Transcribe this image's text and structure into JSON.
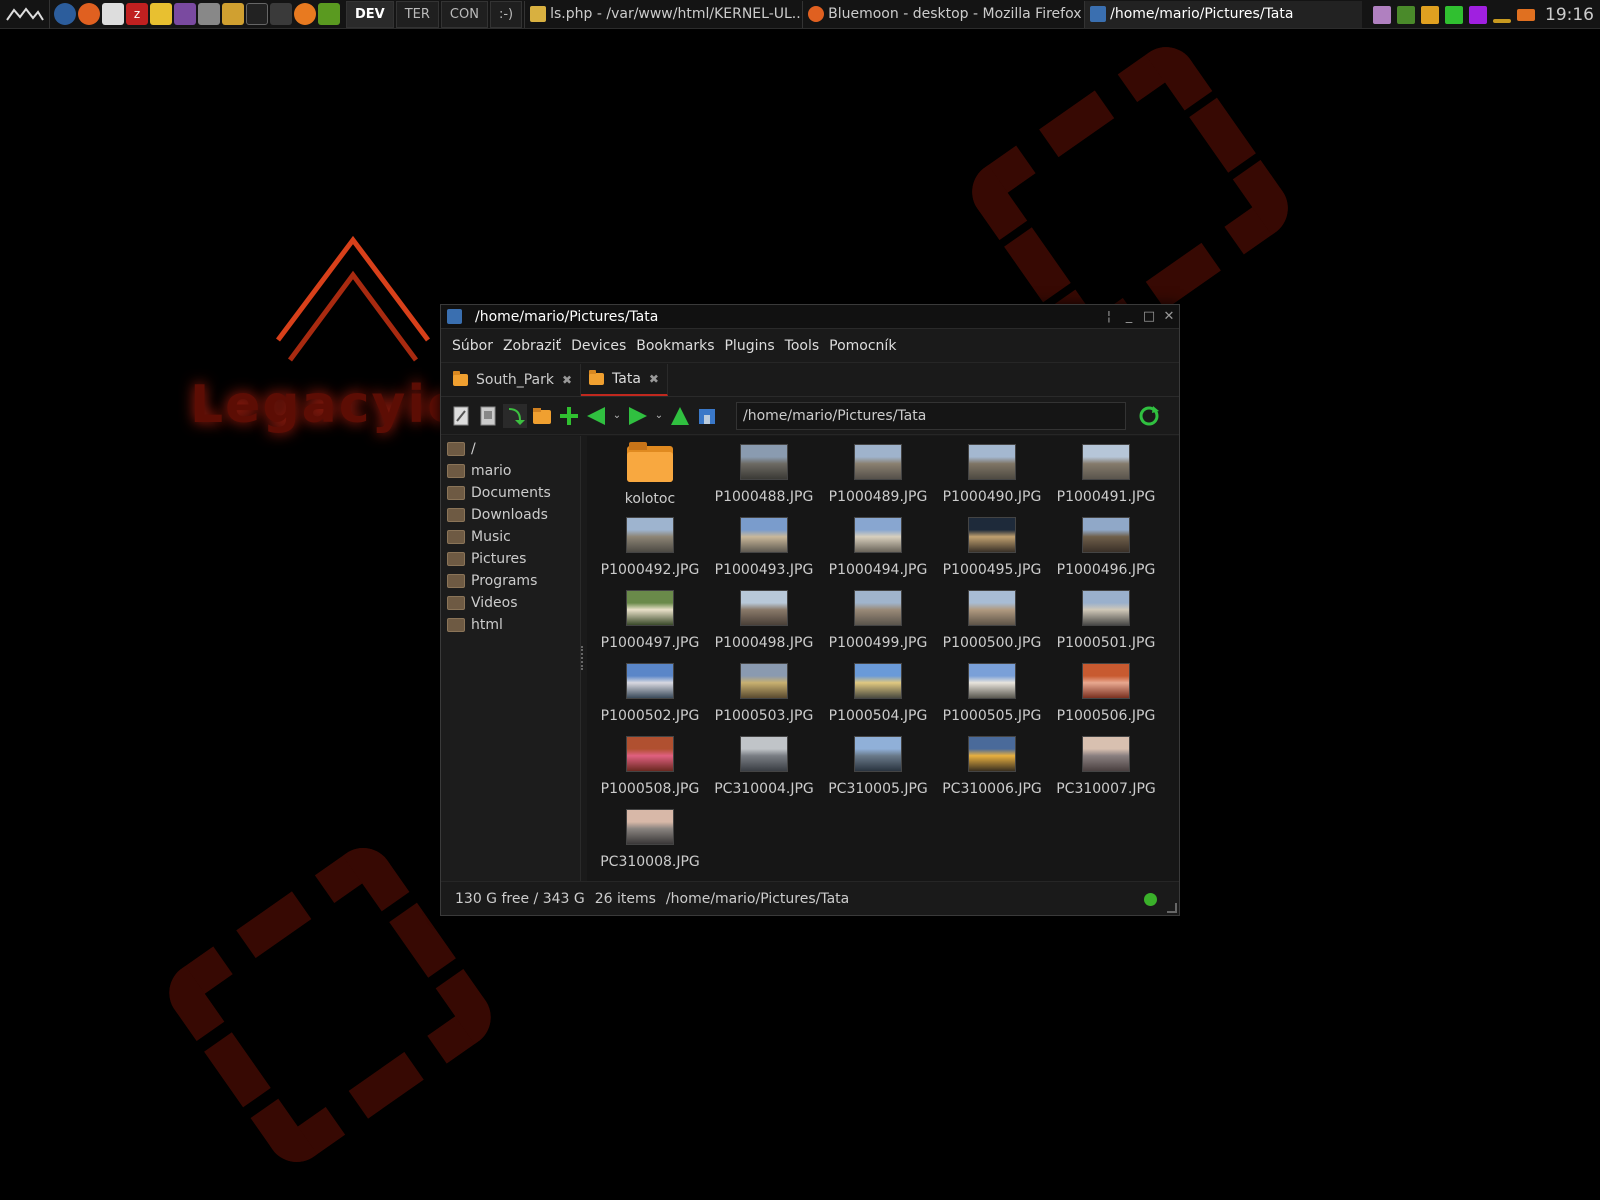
{
  "taskbar": {
    "desktops": [
      "DEV",
      "TER",
      "CON",
      ":-)"
    ],
    "tasks": [
      {
        "label": "ls.php - /var/www/html/KERNEL-UL..."
      },
      {
        "label": "Bluemoon - desktop - Mozilla Firefox"
      },
      {
        "label": "/home/mario/Pictures/Tata"
      }
    ],
    "clock": "19:16"
  },
  "wallpaper": {
    "logo_text": "Legacyic"
  },
  "window": {
    "title": "/home/mario/Pictures/Tata",
    "menu": [
      "Súbor",
      "Zobraziť",
      "Devices",
      "Bookmarks",
      "Plugins",
      "Tools",
      "Pomocník"
    ],
    "tabs": [
      {
        "label": "South_Park",
        "active": false
      },
      {
        "label": "Tata",
        "active": true
      }
    ],
    "address": "/home/mario/Pictures/Tata",
    "sidebar": [
      "/",
      "mario",
      "Documents",
      "Downloads",
      "Music",
      "Pictures",
      "Programs",
      "Videos",
      "html"
    ],
    "files": [
      {
        "name": "kolotoc",
        "type": "folder"
      },
      {
        "name": "P1000488.JPG",
        "type": "image",
        "colors": [
          "#8a9bb0",
          "#6d6a63",
          "#3b3a36"
        ]
      },
      {
        "name": "P1000489.JPG",
        "type": "image",
        "colors": [
          "#9fb3cc",
          "#8a8070",
          "#55504a"
        ]
      },
      {
        "name": "P1000490.JPG",
        "type": "image",
        "colors": [
          "#a4b8d0",
          "#7f7565",
          "#4e4a42"
        ]
      },
      {
        "name": "P1000491.JPG",
        "type": "image",
        "colors": [
          "#b6c6d8",
          "#857b6c",
          "#5a554d"
        ]
      },
      {
        "name": "P1000492.JPG",
        "type": "image",
        "colors": [
          "#9eb4cf",
          "#8d8575",
          "#4d4a44"
        ]
      },
      {
        "name": "P1000493.JPG",
        "type": "image",
        "colors": [
          "#7a9ccc",
          "#c9b89a",
          "#5f5a52"
        ]
      },
      {
        "name": "P1000494.JPG",
        "type": "image",
        "colors": [
          "#88a6d0",
          "#d8cfbd",
          "#6a645a"
        ]
      },
      {
        "name": "P1000495.JPG",
        "type": "image",
        "colors": [
          "#1e2a3a",
          "#c0a070",
          "#3a3128"
        ]
      },
      {
        "name": "P1000496.JPG",
        "type": "image",
        "colors": [
          "#90a8c8",
          "#6f5f4a",
          "#3a3028"
        ]
      },
      {
        "name": "P1000497.JPG",
        "type": "image",
        "colors": [
          "#6a8a4a",
          "#e8e0c8",
          "#3a4a2a"
        ]
      },
      {
        "name": "P1000498.JPG",
        "type": "image",
        "colors": [
          "#b8c8d8",
          "#8a7a6a",
          "#4a4038"
        ]
      },
      {
        "name": "P1000499.JPG",
        "type": "image",
        "colors": [
          "#a0b4cc",
          "#9a8a78",
          "#5a544c"
        ]
      },
      {
        "name": "P1000500.JPG",
        "type": "image",
        "colors": [
          "#a8bcd4",
          "#b09a80",
          "#5e5448"
        ]
      },
      {
        "name": "P1000501.JPG",
        "type": "image",
        "colors": [
          "#9ab0cc",
          "#d0c8b8",
          "#4a4a48"
        ]
      },
      {
        "name": "P1000502.JPG",
        "type": "image",
        "colors": [
          "#5a86c8",
          "#d8d8e0",
          "#3a4a5a"
        ]
      },
      {
        "name": "P1000503.JPG",
        "type": "image",
        "colors": [
          "#8a9ab0",
          "#c8b070",
          "#5a4a30"
        ]
      },
      {
        "name": "P1000504.JPG",
        "type": "image",
        "colors": [
          "#6a9ad8",
          "#e0c880",
          "#4a4a40"
        ]
      },
      {
        "name": "P1000505.JPG",
        "type": "image",
        "colors": [
          "#7aa0d8",
          "#e8e4dc",
          "#5a5850"
        ]
      },
      {
        "name": "P1000506.JPG",
        "type": "image",
        "colors": [
          "#c85a30",
          "#e8a890",
          "#7a3020"
        ]
      },
      {
        "name": "P1000508.JPG",
        "type": "image",
        "colors": [
          "#b05030",
          "#e06080",
          "#6a2820"
        ]
      },
      {
        "name": "PC310004.JPG",
        "type": "image",
        "colors": [
          "#c0c4c8",
          "#7a7e84",
          "#3a3e44"
        ]
      },
      {
        "name": "PC310005.JPG",
        "type": "image",
        "colors": [
          "#90b0d8",
          "#6a7a8a",
          "#2a3440"
        ]
      },
      {
        "name": "PC310006.JPG",
        "type": "image",
        "colors": [
          "#4a6a9a",
          "#e8b040",
          "#3a3020"
        ]
      },
      {
        "name": "PC310007.JPG",
        "type": "image",
        "colors": [
          "#d8c0b0",
          "#8a8080",
          "#4a4040"
        ]
      },
      {
        "name": "PC310008.JPG",
        "type": "image",
        "colors": [
          "#d8b8a8",
          "#8a8480",
          "#3a3838"
        ]
      }
    ],
    "status": {
      "free": "130 G free / 343 G",
      "items": "26 items",
      "path": "/home/mario/Pictures/Tata"
    }
  }
}
